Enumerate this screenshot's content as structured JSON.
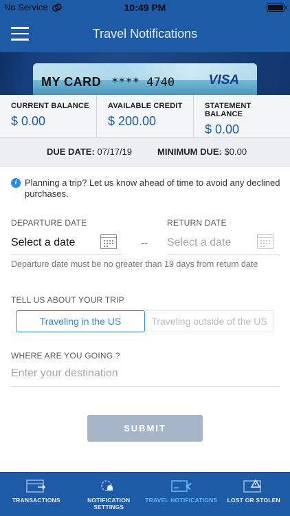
{
  "status_bar": {
    "carrier": "No Service",
    "time": "10:49 PM"
  },
  "nav": {
    "title": "Travel Notifications"
  },
  "card": {
    "name": "MY CARD",
    "number_mask": "****",
    "last4": "4740",
    "network": "VISA"
  },
  "balances": [
    {
      "label": "CURRENT BALANCE",
      "value": "$ 0.00"
    },
    {
      "label": "AVAILABLE CREDIT",
      "value": "$ 200.00"
    },
    {
      "label": "STATEMENT BALANCE",
      "value": "$ 0.00"
    }
  ],
  "due": {
    "due_label": "DUE DATE:",
    "due_value": "07/17/19",
    "min_label": "MINIMUM DUE:",
    "min_value": "$0.00"
  },
  "info": {
    "icon": "info-icon",
    "text": "Planning a trip? Let us know ahead of time to avoid any declined purchases."
  },
  "dates": {
    "departure_label": "DEPARTURE DATE",
    "departure_value": "Select a date",
    "separator": "--",
    "return_label": "RETURN DATE",
    "return_value": "Select a date",
    "hint": "Departure date must be no greater than 19 days from return date"
  },
  "trip": {
    "label": "TELL US ABOUT YOUR TRIP",
    "options": [
      "Traveling in the US",
      "Traveling outside of the US"
    ],
    "selected": "Traveling in the US"
  },
  "destination": {
    "label": "WHERE ARE YOU GOING ?",
    "placeholder": "Enter your destination",
    "value": ""
  },
  "submit_label": "SUBMIT",
  "tabs": [
    {
      "label": "TRANSACTIONS",
      "icon": "transactions-icon"
    },
    {
      "label": "NOTIFICATION SETTINGS",
      "icon": "notification-settings-icon"
    },
    {
      "label": "TRAVEL NOTIFICATIONS",
      "icon": "travel-notifications-icon",
      "active": true
    },
    {
      "label": "LOST OR STOLEN",
      "icon": "lost-stolen-icon"
    }
  ],
  "colors": {
    "brand": "#1d5ba6",
    "accent": "#2c8ae8",
    "active_tab": "#62b6f5",
    "submit_disabled": "#a6b6c8"
  }
}
